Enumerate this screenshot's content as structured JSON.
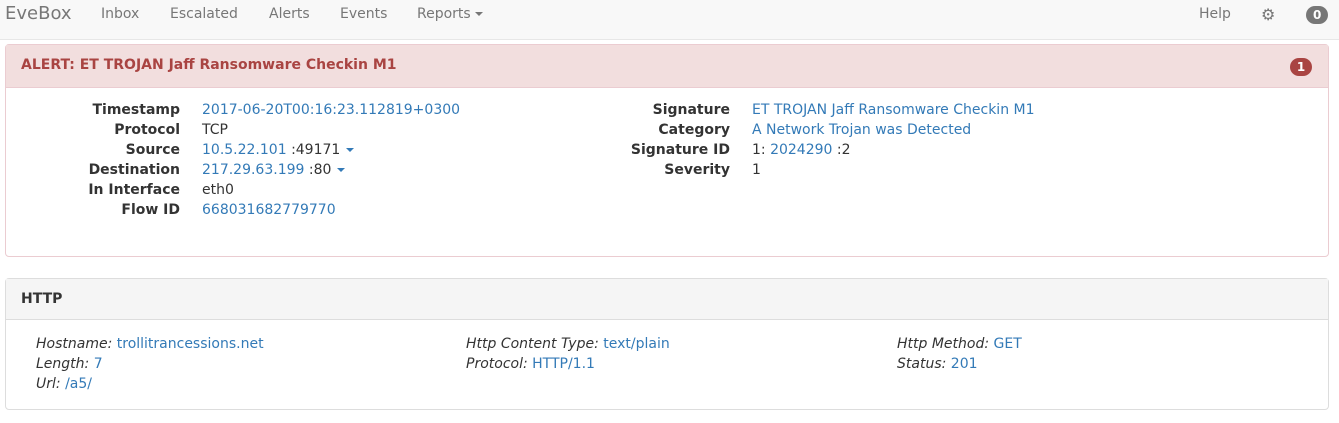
{
  "navbar": {
    "brand": "EveBox",
    "items": [
      "Inbox",
      "Escalated",
      "Alerts",
      "Events"
    ],
    "reports_label": "Reports",
    "help_label": "Help",
    "gear_icon": "gear-icon",
    "badge_count": "0"
  },
  "alert": {
    "title": "ALERT: ET TROJAN Jaff Ransomware Checkin M1",
    "count": "1",
    "left": {
      "timestamp_label": "Timestamp",
      "timestamp": "2017-06-20T00:16:23.112819+0300",
      "protocol_label": "Protocol",
      "protocol": "TCP",
      "source_label": "Source",
      "source_ip": "10.5.22.101",
      "source_port": ":49171",
      "destination_label": "Destination",
      "destination_ip": "217.29.63.199",
      "destination_port": ":80",
      "in_interface_label": "In Interface",
      "in_interface": "eth0",
      "flow_id_label": "Flow ID",
      "flow_id": "668031682779770"
    },
    "right": {
      "signature_label": "Signature",
      "signature": "ET TROJAN Jaff Ransomware Checkin M1",
      "category_label": "Category",
      "category": "A Network Trojan was Detected",
      "signature_id_label": "Signature ID",
      "signature_id_gid": "1:",
      "signature_id": "2024290",
      "signature_id_rev": ":2",
      "severity_label": "Severity",
      "severity": "1"
    }
  },
  "http": {
    "title": "HTTP",
    "hostname_label": "Hostname:",
    "hostname": "trollitrancessions.net",
    "length_label": "Length:",
    "length": "7",
    "url_label": "Url:",
    "url": "/a5/",
    "content_type_label": "Http Content Type:",
    "content_type": "text/plain",
    "protocol_label": "Protocol:",
    "protocol": "HTTP/1.1",
    "method_label": "Http Method:",
    "method": "GET",
    "status_label": "Status:",
    "status": "201"
  }
}
